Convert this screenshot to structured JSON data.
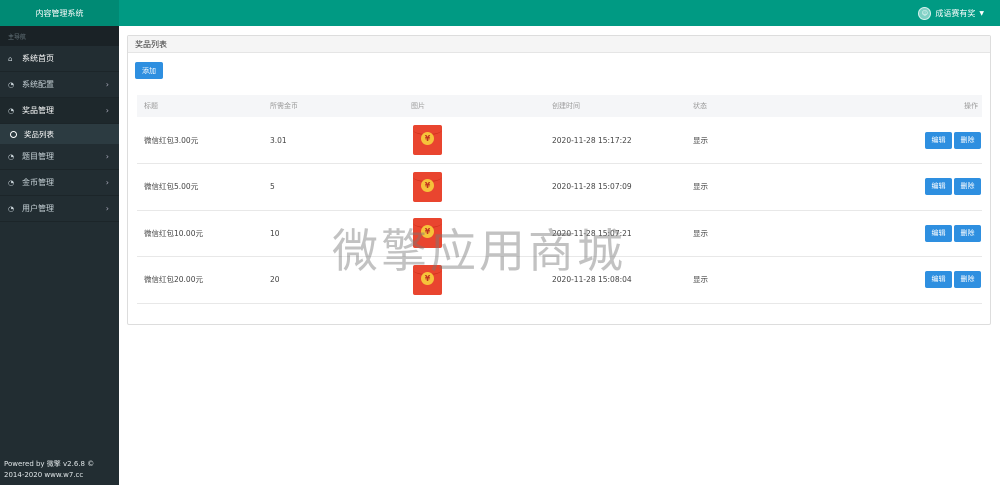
{
  "app": {
    "title": "内容管理系统"
  },
  "user": {
    "name": "成语赛有奖"
  },
  "sidebar": {
    "header": "主导航",
    "items": [
      {
        "label": "系统首页",
        "icon": "home-icon"
      },
      {
        "label": "系统配置",
        "icon": "gauge-icon"
      },
      {
        "label": "奖品管理",
        "icon": "gauge-icon"
      },
      {
        "label": "题目管理",
        "icon": "gauge-icon"
      },
      {
        "label": "金币管理",
        "icon": "gauge-icon"
      },
      {
        "label": "用户管理",
        "icon": "gauge-icon"
      }
    ],
    "sub_item": "奖品列表",
    "footer_line1": "Powered by 微擎 v2.6.8 ©",
    "footer_line2": "2014-2020 www.w7.cc"
  },
  "panel": {
    "title": "奖品列表",
    "add_label": "添加"
  },
  "table": {
    "headers": [
      "标题",
      "所需金币",
      "图片",
      "创建时间",
      "状态",
      "操作"
    ],
    "rows": [
      {
        "title": "微信红包3.00元",
        "coins": "3.01",
        "created": "2020-11-28 15:17:22",
        "status": "显示"
      },
      {
        "title": "微信红包5.00元",
        "coins": "5",
        "created": "2020-11-28 15:07:09",
        "status": "显示"
      },
      {
        "title": "微信红包10.00元",
        "coins": "10",
        "created": "2020-11-28 15:07:21",
        "status": "显示"
      },
      {
        "title": "微信红包20.00元",
        "coins": "20",
        "created": "2020-11-28 15:08:04",
        "status": "显示"
      }
    ],
    "edit_label": "编辑",
    "delete_label": "删除",
    "yuan_symbol": "¥"
  },
  "watermark": "微擎应用商城",
  "colors": {
    "topbar": "#009a83",
    "sidebar": "#222d32",
    "button": "#2e8fe0",
    "redpack": "#e9452f"
  }
}
